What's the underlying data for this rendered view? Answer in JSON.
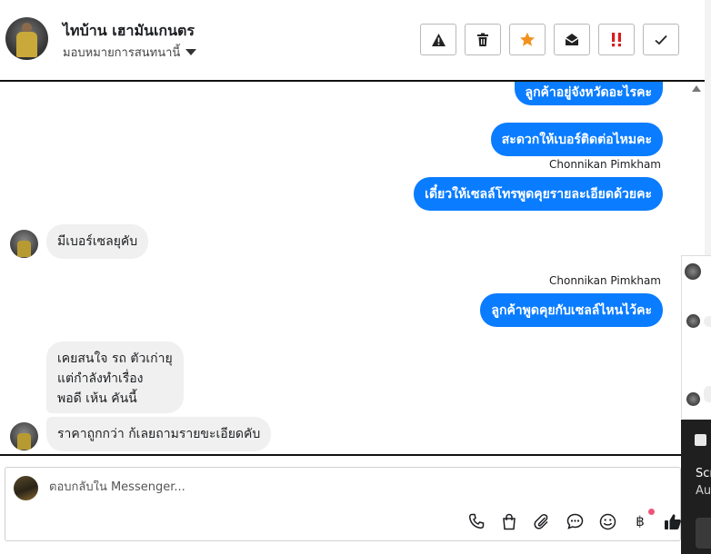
{
  "header": {
    "contact_name": "ไทบ้าน เฮามันเกนตร",
    "assign_label": "มอบหมายการสนทนานี้",
    "toolbar": [
      {
        "name": "spam-button",
        "glyph": "⚠"
      },
      {
        "name": "delete-button",
        "glyph": "🗑"
      },
      {
        "name": "star-button",
        "glyph": "★"
      },
      {
        "name": "mark-unread-button",
        "glyph": "✉"
      },
      {
        "name": "follow-up-button",
        "glyph": "‼"
      },
      {
        "name": "mark-done-button",
        "glyph": "✓"
      }
    ]
  },
  "messages": {
    "m1": "ลูกค้าอยู่จังหวัดอะไรคะ",
    "m2": "สะดวกให้เบอร์ติดต่อไหมคะ",
    "sender1": "Chonnikan Pimkham",
    "m3": "เดี๋ยวให้เซลล์โทรพูดคุยรายละเอียดด้วยคะ",
    "m4": "มีเบอร์เซลยุคับ",
    "sender2": "Chonnikan Pimkham",
    "m5": "ลูกค้าพูดคุยกับเซลล์ไหนไว้คะ",
    "m6_line1": "เคยสนใจ รถ ตัวเก่ายุ",
    "m6_line2": "แต่กำลังทำเรื่อง",
    "m6_line3": "พอดี เห้น คันนี้",
    "m7": "ราคาถูกกว่า ก้เลยถามรายขะเอียดคับ"
  },
  "composer": {
    "placeholder": "ตอบกลับใน Messenger...",
    "icons": [
      "phone-icon",
      "shopping-bag-icon",
      "attachment-icon",
      "saved-reply-icon",
      "emoji-icon",
      "baht-icon",
      "thumbs-up-icon"
    ]
  },
  "side_card": {
    "title": "Scr",
    "subtitle": "Au"
  },
  "colors": {
    "outgoing_bubble": "#0a7cff",
    "incoming_bubble": "#f0f0f0",
    "star": "#f2911d",
    "urgent": "#d91c1c",
    "notification_dot": "#f0567a"
  }
}
